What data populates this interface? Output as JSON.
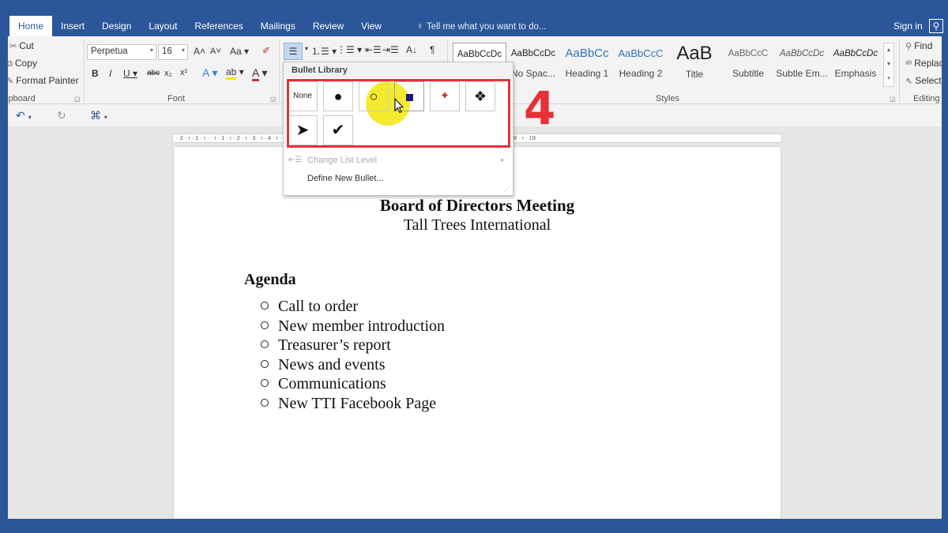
{
  "window": {
    "tabs": [
      "Home",
      "Insert",
      "Design",
      "Layout",
      "References",
      "Mailings",
      "Review",
      "View"
    ],
    "active_tab": "Home",
    "tell_me": "Tell me what you want to do...",
    "sign_in": "Sign in",
    "accent": "#2b579a"
  },
  "ribbon": {
    "clipboard": {
      "cut": "Cut",
      "copy": "Copy",
      "format_painter": "Format Painter",
      "label": "ipboard"
    },
    "font": {
      "font_name": "Perpetua",
      "font_size": "16",
      "label": "Font"
    },
    "styles": {
      "items": [
        {
          "preview": "AaBbCcDc",
          "name": ""
        },
        {
          "preview": "AaBbCcDc",
          "name": "No Spac..."
        },
        {
          "preview": "AaBbCc",
          "name": "Heading 1"
        },
        {
          "preview": "AaBbCcC",
          "name": "Heading 2"
        },
        {
          "preview": "AaB",
          "name": "Title"
        },
        {
          "preview": "AaBbCcC",
          "name": "Subtitle"
        },
        {
          "preview": "AaBbCcDc",
          "name": "Subtle Em..."
        },
        {
          "preview": "AaBbCcDc",
          "name": "Emphasis"
        }
      ],
      "label": "Styles"
    },
    "editing": {
      "find": "Find",
      "replace": "Replac",
      "select": "Select",
      "label": "Editing"
    }
  },
  "bullet_menu": {
    "header": "Bullet Library",
    "none_label": "None",
    "change_list_level": "Change List Level",
    "define_new_bullet": "Define New Bullet..."
  },
  "annotation": {
    "step": "4",
    "color": "#e53238"
  },
  "ruler": {
    "text": "· 2 · ı · 1 · ı ·   · ı · 1 · ı · 2 · ı · 3 · ı · 4 · ı · 5 · ı · 6 · ı · 7 · ı · 8 · ı · 9 · ı · 10 · ı · 11 · ı · 12 · ı · 13 · ı · 14 · ı · 15 · ı · 16 · ı · 17 · ı · 18 · ı · 19"
  },
  "document": {
    "title": "Board of Directors Meeting",
    "subtitle": "Tall Trees International",
    "agenda_heading": "Agenda",
    "agenda_items": [
      "Call to order",
      "New member introduction",
      "Treasurer’s report",
      "News and events",
      "Communications",
      "New TTI Facebook Page"
    ]
  }
}
